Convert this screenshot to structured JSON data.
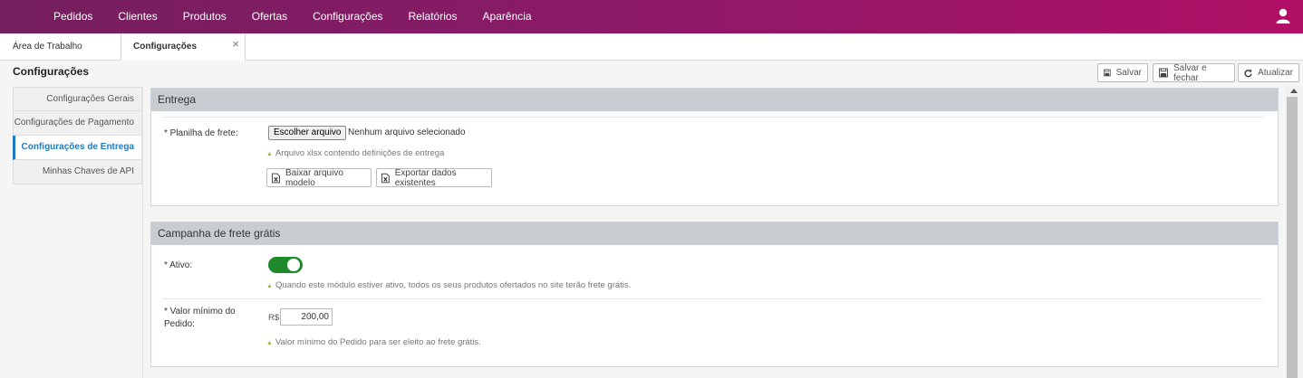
{
  "nav": {
    "items": [
      "Pedidos",
      "Clientes",
      "Produtos",
      "Ofertas",
      "Configurações",
      "Relatórios",
      "Aparência"
    ],
    "user_icon": "user-icon"
  },
  "tabs": {
    "home": "Área de Trabalho",
    "active": "Configurações",
    "close": "×"
  },
  "page": {
    "title": "Configurações"
  },
  "toolbar": {
    "save_label": "Salvar",
    "save_close_label": "Salvar e fechar",
    "refresh_label": "Atualizar"
  },
  "sidebar": {
    "items": [
      {
        "label": "Configurações Gerais",
        "active": false
      },
      {
        "label": "Configurações de Pagamento",
        "active": false
      },
      {
        "label": "Configurações de Entrega",
        "active": true
      },
      {
        "label": "Minhas Chaves de API",
        "active": false
      }
    ]
  },
  "entrega": {
    "title": "Entrega",
    "planilha_label": "* Planilha de frete:",
    "file_button": "Escolher arquivo",
    "file_status": "Nenhum arquivo selecionado",
    "file_hint": "Arquivo xlsx contendo definições de entrega",
    "download_model": "Baixar arquivo modelo",
    "export_data": "Exportar dados existentes"
  },
  "campanha": {
    "title": "Campanha de frete grátis",
    "ativo_label": "* Ativo:",
    "ativo_value": true,
    "ativo_hint": "Quando este módulo estiver ativo, todos os seus produtos ofertados no site terão frete grátis.",
    "valor_label_1": "* Valor mínimo do",
    "valor_label_2": "Pedido:",
    "currency": "R$",
    "valor_value": "200,00",
    "valor_hint": "Valor mínimo do Pedido para ser eleito ao frete grátis."
  },
  "colors": {
    "brand_gradient_start": "#751f5e",
    "brand_gradient_end": "#b01066",
    "active_link": "#1f7bc1",
    "toggle_on": "#1e8a2c",
    "hint_triangle": "#8fbf3a"
  }
}
